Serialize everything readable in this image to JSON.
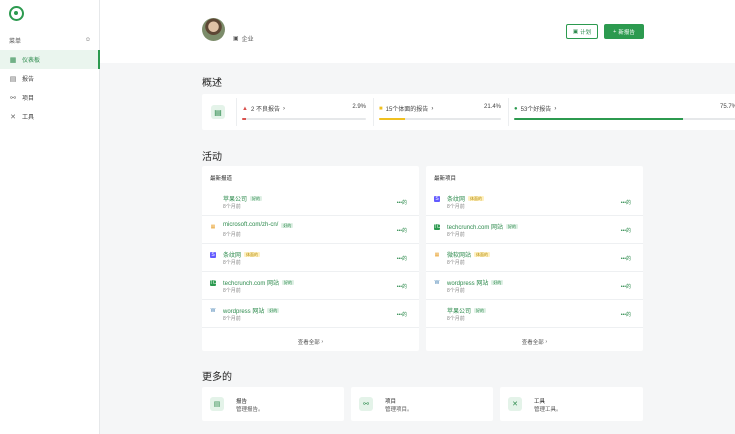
{
  "sidebar": {
    "menu_label": "菜单",
    "items": [
      {
        "label": "仪表板",
        "icon": "grid-icon"
      },
      {
        "label": "报告",
        "icon": "report-icon"
      },
      {
        "label": "项目",
        "icon": "project-icon"
      },
      {
        "label": "工具",
        "icon": "tools-icon"
      }
    ]
  },
  "header": {
    "company": "企业",
    "plan_label": "计划",
    "new_report_label": "新报告"
  },
  "overview": {
    "title": "概述",
    "cells": [
      {
        "label": "2 不良报告",
        "percent": "2.9%",
        "fill": 2.9,
        "color": "#d9534f",
        "icon": "warning-triangle-icon"
      },
      {
        "label": "15个体面的报告",
        "percent": "21.4%",
        "fill": 21.4,
        "color": "#f0c020",
        "icon": "square-icon"
      },
      {
        "label": "53个好报告",
        "percent": "75.7%",
        "fill": 75.7,
        "color": "#2c9a4f",
        "icon": "circle-icon"
      }
    ]
  },
  "activity": {
    "title": "活动",
    "reports": {
      "title": "最新报道",
      "view_all": "查看全部",
      "items": [
        {
          "name": "苹果公司",
          "badge": "好的",
          "badge_type": "cert",
          "time": "8个月前",
          "icon": "apple-icon"
        },
        {
          "name": "microsoft.com/zh-cn/",
          "badge": "好的",
          "badge_type": "cert",
          "time": "8个月前",
          "icon": "microsoft-icon"
        },
        {
          "name": "条纹网",
          "badge": "体面的",
          "badge_type": "pend",
          "time": "8个月前",
          "icon": "stripe-icon"
        },
        {
          "name": "techcrunch.com 网站",
          "badge": "好的",
          "badge_type": "cert",
          "time": "8个月前",
          "icon": "techcrunch-icon"
        },
        {
          "name": "wordpress 网站",
          "badge": "好的",
          "badge_type": "cert",
          "time": "8个月前",
          "icon": "wordpress-icon"
        }
      ]
    },
    "projects": {
      "title": "最新项目",
      "view_all": "查看全部",
      "items": [
        {
          "name": "条纹网",
          "badge": "体面的",
          "badge_type": "pend",
          "time": "8个月前",
          "icon": "stripe-icon"
        },
        {
          "name": "techcrunch.com 网站",
          "badge": "好的",
          "badge_type": "cert",
          "time": "8个月前",
          "icon": "techcrunch-icon"
        },
        {
          "name": "微软网站",
          "badge": "体面的",
          "badge_type": "pend",
          "time": "8个月前",
          "icon": "microsoft-icon"
        },
        {
          "name": "wordpress 网站",
          "badge": "好的",
          "badge_type": "cert",
          "time": "8个月前",
          "icon": "wordpress-icon"
        },
        {
          "name": "苹果公司",
          "badge": "好的",
          "badge_type": "cert",
          "time": "8个月前",
          "icon": "apple-icon"
        }
      ]
    },
    "more_label": "•••的"
  },
  "more": {
    "title": "更多的",
    "cards": [
      {
        "title": "报告",
        "desc": "管理报告。",
        "icon": "report-icon"
      },
      {
        "title": "项目",
        "desc": "管理项目。",
        "icon": "project-icon"
      },
      {
        "title": "工具",
        "desc": "管理工具。",
        "icon": "tools-icon"
      }
    ]
  }
}
